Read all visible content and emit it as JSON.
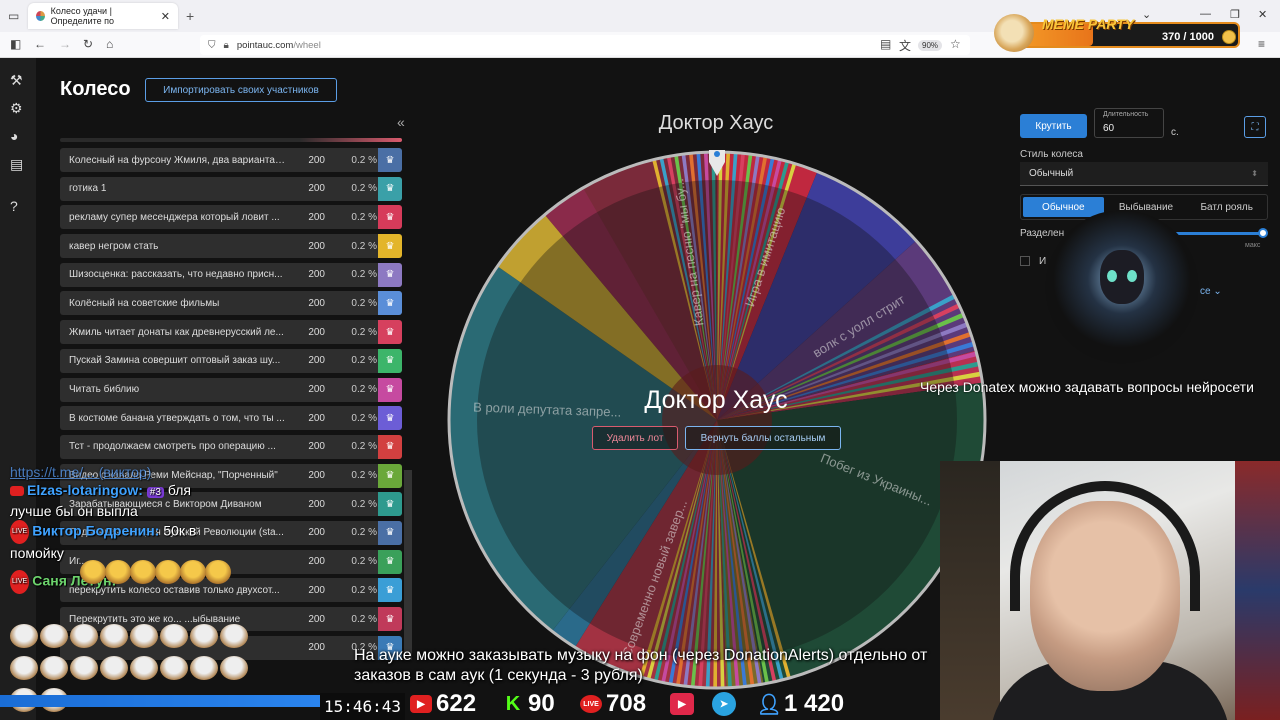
{
  "browser": {
    "tab_title": "Колесо удачи | Определите по",
    "url_host": "pointauc.com",
    "url_path": "/wheel",
    "zoom": "90%"
  },
  "meme_party": {
    "title": "MEME PARTY",
    "score": "370 / 1000",
    "progress": 0.37
  },
  "page": {
    "title": "Колесо",
    "import_button": "Импортировать своих участников",
    "collapse": "«"
  },
  "lots": [
    {
      "name": "Колесный на фурсону Жмиля, два варианта:...",
      "amount": "200",
      "percent": "0.2 %",
      "color": "#4a6fa5"
    },
    {
      "name": "готика 1",
      "amount": "200",
      "percent": "0.2 %",
      "color": "#3aa0a8"
    },
    {
      "name": "рекламу супер месенджера который ловит ...",
      "amount": "200",
      "percent": "0.2 %",
      "color": "#d63b5a"
    },
    {
      "name": "кавер негром стать",
      "amount": "200",
      "percent": "0.2 %",
      "color": "#e3b52a"
    },
    {
      "name": "Шизосценка: рассказать, что недавно присн...",
      "amount": "200",
      "percent": "0.2 %",
      "color": "#8d79c2"
    },
    {
      "name": "Колёсный на советские фильмы",
      "amount": "200",
      "percent": "0.2 %",
      "color": "#5a8ed8"
    },
    {
      "name": "Жмиль читает донаты как древнерусский ле...",
      "amount": "200",
      "percent": "0.2 %",
      "color": "#d6405e"
    },
    {
      "name": "Пускай Замина совершит оптовый заказ шу...",
      "amount": "200",
      "percent": "0.2 %",
      "color": "#3cb56a"
    },
    {
      "name": "Читать библию",
      "amount": "200",
      "percent": "0.2 %",
      "color": "#c64aa0"
    },
    {
      "name": "В костюме банана утверждать о том, что ты ...",
      "amount": "200",
      "percent": "0.2 %",
      "color": "#6c5dd6"
    },
    {
      "name": "Тст - продолжаем смотреть про операцию ...",
      "amount": "200",
      "percent": "0.2 %",
      "color": "#d24040"
    },
    {
      "name": "Видео с канала Реми Мейснар, \"Порченный\"",
      "amount": "200",
      "percent": "0.2 %",
      "color": "#6aa83a"
    },
    {
      "name": "Зарабатывающиеся с Виктором Диваном",
      "amount": "200",
      "percent": "0.2 %",
      "color": "#2e9a8e"
    },
    {
      "name": "Подлинная история Русской Революции (sta...",
      "amount": "200",
      "percent": "0.2 %",
      "color": "#4a6fa5"
    },
    {
      "name": "Иг...",
      "amount": "200",
      "percent": "0.2 %",
      "color": "#3aa05a"
    },
    {
      "name": "перекрутить колесо оставив только двухсот...",
      "amount": "200",
      "percent": "0.2 %",
      "color": "#3a9ed6"
    },
    {
      "name": "Перекрутить это же ко... ...ыбывание",
      "amount": "200",
      "percent": "0.2 %",
      "color": "#c03a5a"
    },
    {
      "name": "",
      "amount": "200",
      "percent": "0.2 %",
      "color": "#3a7ab6"
    }
  ],
  "wheel": {
    "title": "Доктор Хаус",
    "winner": "Доктор Хаус",
    "delete_button": "Удалить лот",
    "return_button": "Вернуть баллы остальным",
    "labels": [
      "Кавер на песню \"мы бу...",
      "Игра в имитацию",
      "волк с уолл стрит",
      "Побег из Украины...",
      "Современно новый завер...",
      "В роли депутата запре..."
    ]
  },
  "panel": {
    "spin_button": "Крутить",
    "duration_label": "Длительность",
    "duration_value": "60",
    "seconds": "с.",
    "style_label": "Стиль колеса",
    "style_value": "Обычный",
    "modes": [
      "Обычное",
      "Выбывание",
      "Батл рояль"
    ],
    "separator_label": "Разделен",
    "max_label": "макс",
    "check_label": "И",
    "more_label": "се"
  },
  "overlay": {
    "donatex": "Через Donatex можно задавать вопросы нейросети",
    "chat_link": "https://t.me/... (виктор)",
    "chat1_nick": "Elzas-lotaringow:",
    "chat1_badge": "#3",
    "chat1_text": "бля",
    "chat1_text2": "лучше бы он выпла",
    "chat2_nick": "Виктор Бодренин:",
    "chat2_text": "50к в",
    "chat2_text2": "помойку",
    "chat3_nick": "Саня Летун:",
    "caption": "На ауке можно заказывать музыку на фон (через DonationAlerts) отдельно от заказов в сам аук (1 секунда - 3 рубля)",
    "time": "15:46:43",
    "youtube_count": "622",
    "kick_count": "90",
    "vk_count": "708",
    "tg_viewers": "1 420",
    "live_label": "LIVE"
  }
}
